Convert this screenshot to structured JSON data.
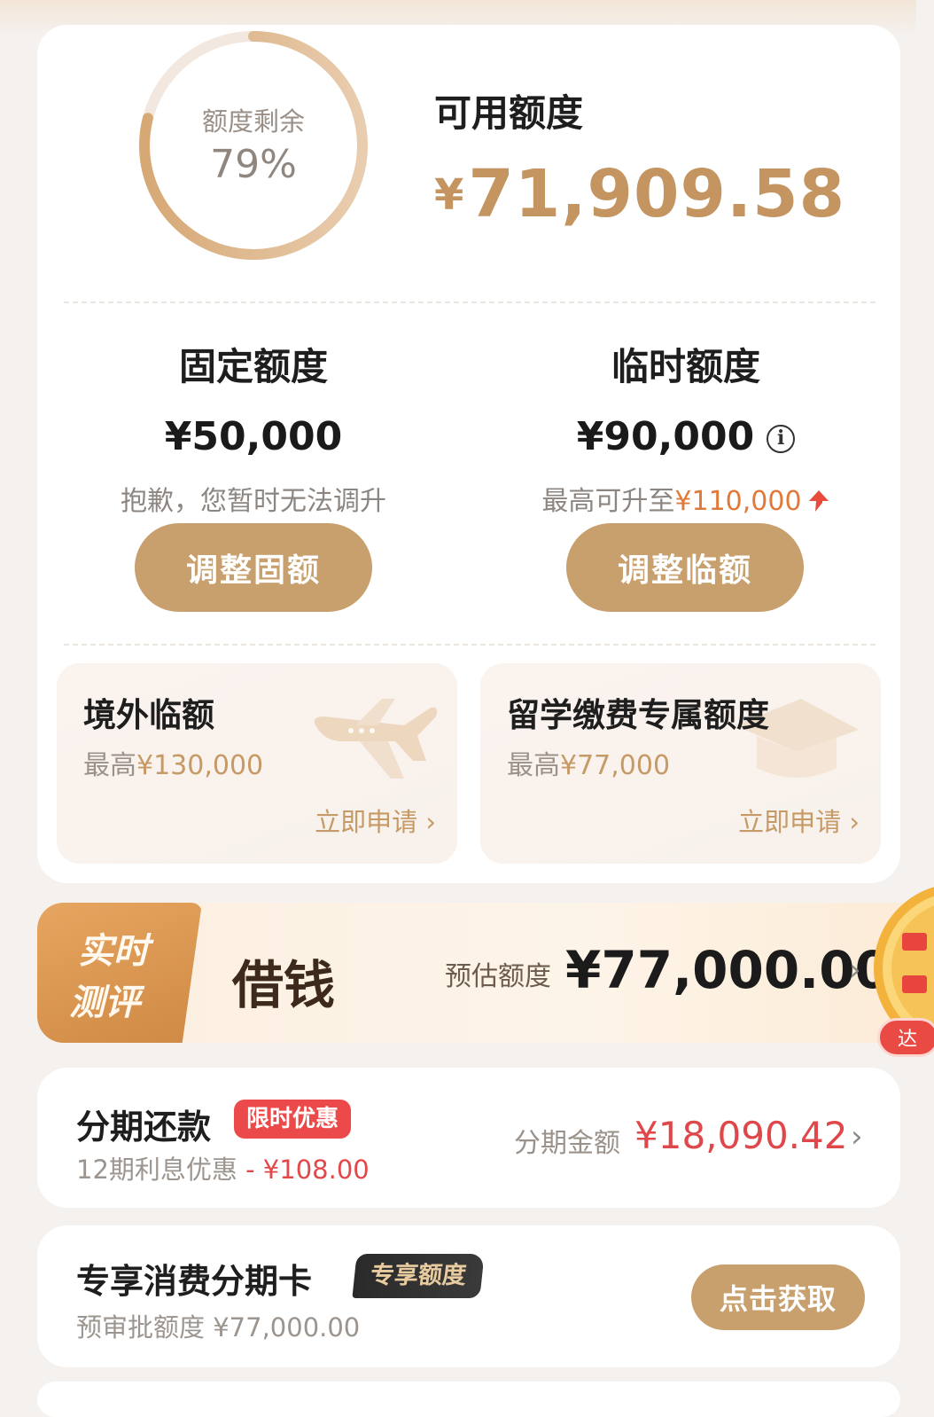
{
  "credit": {
    "ring_label": "额度剩余",
    "ring_percent": "79%",
    "ring_value": 0.79,
    "available_title": "可用额度",
    "available_currency": "¥",
    "available_amount": "71,909.58"
  },
  "fixed": {
    "title": "固定额度",
    "amount": "¥50,000",
    "note": "抱歉，您暂时无法调升",
    "button": "调整固额"
  },
  "temporary": {
    "title": "临时额度",
    "amount": "¥90,000",
    "info_icon": "i",
    "note_prefix": "最高可升至",
    "note_amount": "¥110,000",
    "button": "调整临额"
  },
  "overseas": {
    "title": "境外临额",
    "max_prefix": "最高",
    "max_amount": "¥130,000",
    "apply": "立即申请 ›",
    "icon": "airplane-icon"
  },
  "study": {
    "title": "留学缴费专属额度",
    "max_prefix": "最高",
    "max_amount": "¥77,000",
    "apply": "立即申请 ›",
    "icon": "graduation-cap-icon"
  },
  "borrow": {
    "badge_line1": "实时",
    "badge_line2": "测评",
    "title": "借钱",
    "estimate_label": "预估额度",
    "estimate_amount": "¥77,000.00",
    "chevron": "›",
    "wheel_tag": "达"
  },
  "installment": {
    "title": "分期还款",
    "tag": "限时优惠",
    "sub_prefix": "12期利息优惠",
    "sub_discount": "- ¥108.00",
    "amount_label": "分期金额",
    "amount": "¥18,090.42",
    "chevron": "›"
  },
  "exclusive": {
    "title": "专享消费分期卡",
    "tag": "专享额度",
    "sub": "预审批额度  ¥77,000.00",
    "button": "点击获取"
  },
  "colors": {
    "gold": "#c8a06e",
    "gold_text": "#c49560",
    "red": "#e0474a"
  }
}
